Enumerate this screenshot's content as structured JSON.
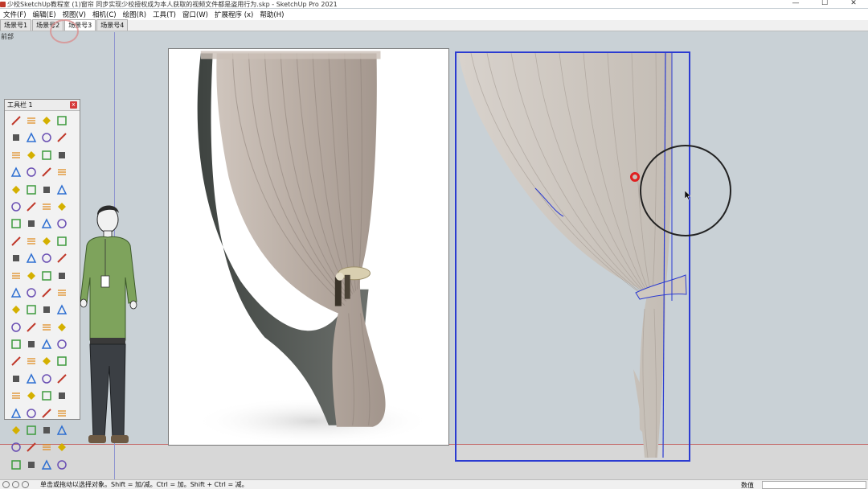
{
  "window": {
    "title": "少校SketchUp教程室 (1)窗帘 同步实现少校授权成为本人获取的视频文件都是盗用行为.skp - SketchUp Pro 2021",
    "minimize": "—",
    "maximize": "☐",
    "close": "✕"
  },
  "menu": {
    "items": [
      "文件(F)",
      "编辑(E)",
      "视图(V)",
      "相机(C)",
      "绘图(R)",
      "工具(T)",
      "窗口(W)",
      "扩展程序 (x)",
      "帮助(H)"
    ]
  },
  "scene_tabs": {
    "tabs": [
      "场景号1",
      "场景号2",
      "场景号3",
      "场景号4"
    ],
    "active_index": 2
  },
  "viewport": {
    "view_label": "前部"
  },
  "toolbar": {
    "title": "工具栏 1",
    "close": "x",
    "tool_count": 84
  },
  "status": {
    "text": "单击或拖动以选择对象。Shift = 加/减。Ctrl = 加。Shift + Ctrl = 减。",
    "measure_label": "数值",
    "measure_value": ""
  },
  "colors": {
    "selection_blue": "#2b3bd1",
    "click_highlight": "#e02020",
    "viewport_bg": "#c9d1d6"
  }
}
